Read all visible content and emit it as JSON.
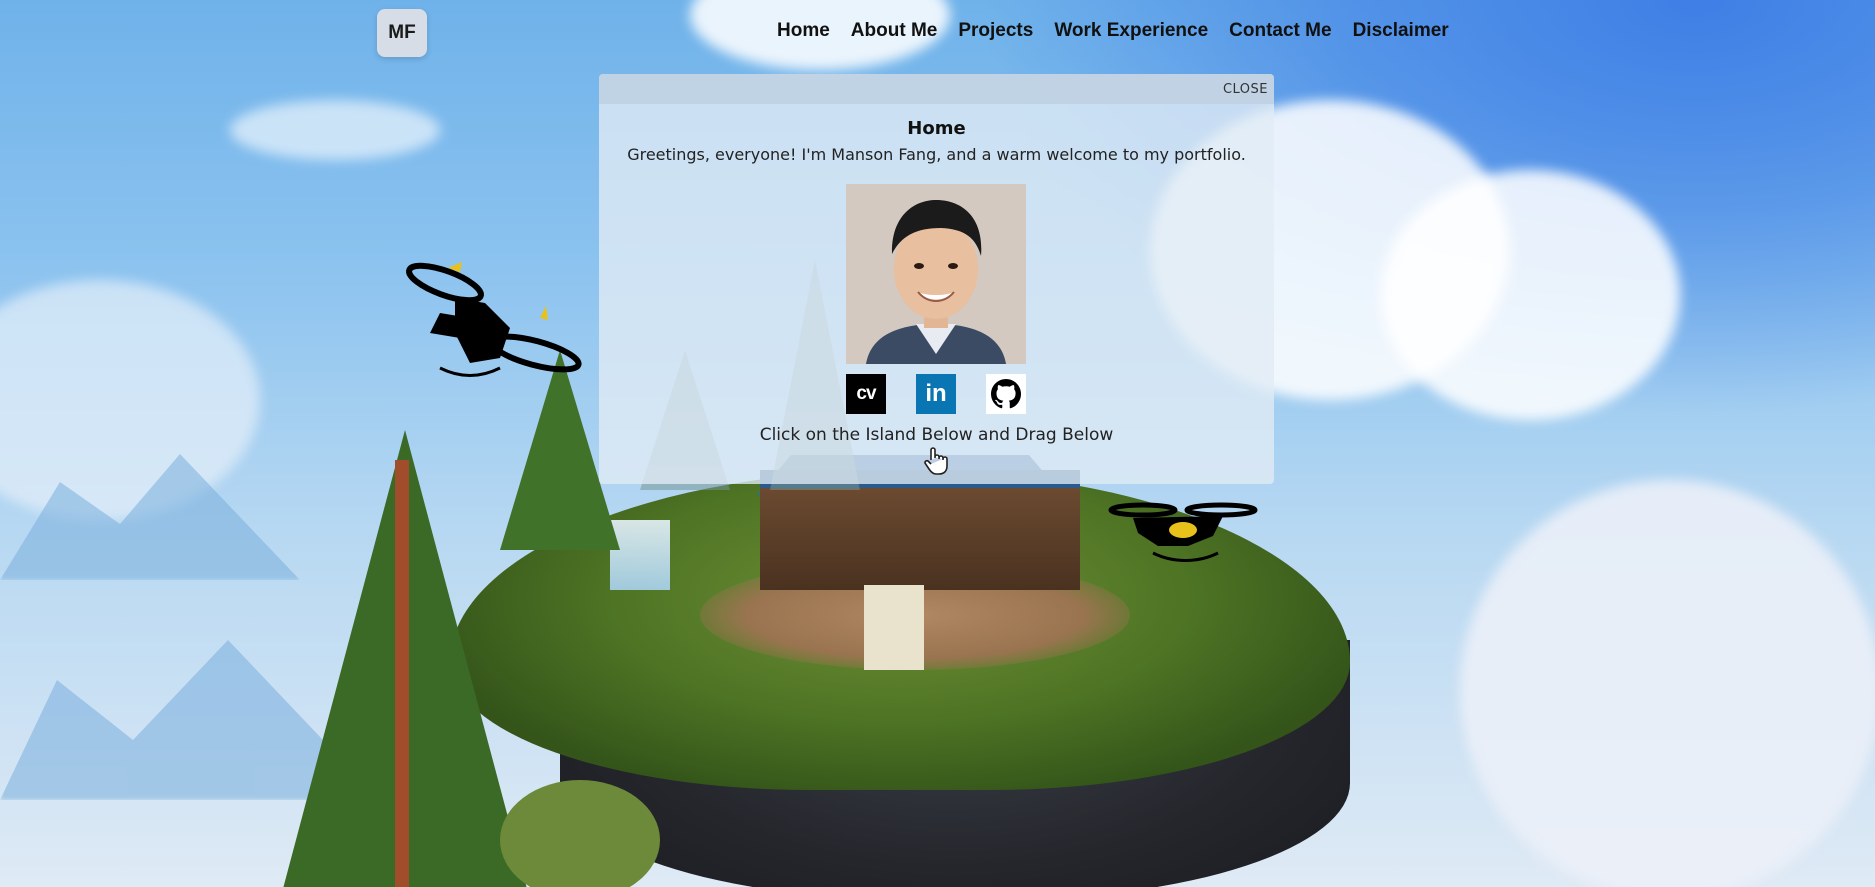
{
  "header": {
    "logo_text": "MF",
    "nav": [
      {
        "label": "Home"
      },
      {
        "label": "About Me"
      },
      {
        "label": "Projects"
      },
      {
        "label": "Work Experience"
      },
      {
        "label": "Contact Me"
      },
      {
        "label": "Disclaimer"
      }
    ]
  },
  "modal": {
    "close_label": "CLOSE",
    "title": "Home",
    "greeting": "Greetings, everyone! I'm Manson Fang, and a warm welcome to my portfolio.",
    "social": [
      {
        "name": "cv",
        "label": "CV"
      },
      {
        "name": "linkedin",
        "label": "in"
      },
      {
        "name": "github",
        "icon": "github-icon"
      }
    ],
    "hint": "Click on the Island Below and Drag Below",
    "hint_icon": "hand-pointer-icon"
  },
  "colors": {
    "linkedin": "#0a75b3",
    "sky": "#6fb2ea"
  }
}
